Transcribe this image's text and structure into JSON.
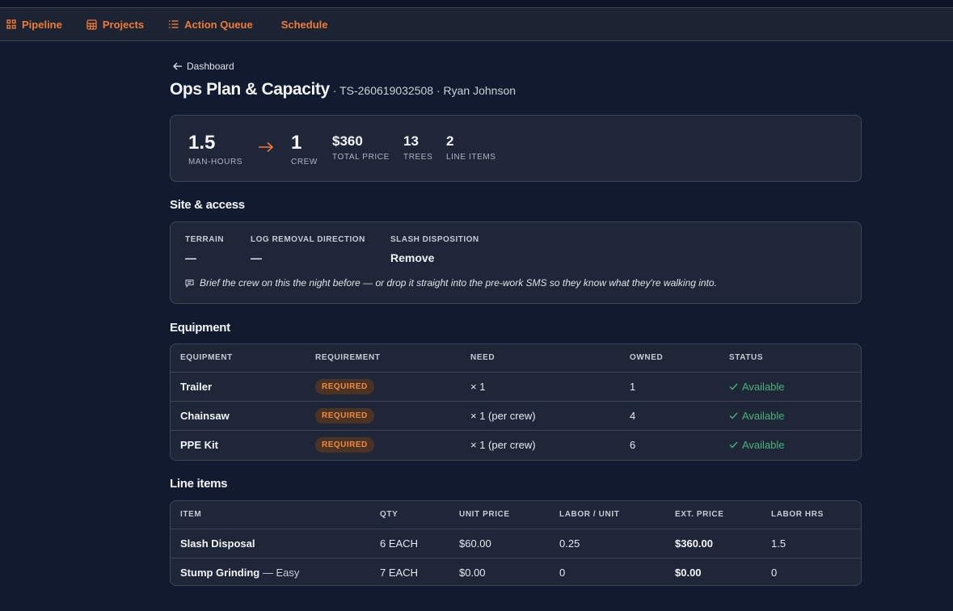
{
  "nav": {
    "items": [
      {
        "label": "Pipeline",
        "icon": "grid-icon"
      },
      {
        "label": "Projects",
        "icon": "calendar-grid-icon"
      },
      {
        "label": "Action Queue",
        "icon": "list-icon"
      },
      {
        "label": "Schedule",
        "icon": ""
      }
    ]
  },
  "back_link": "Dashboard",
  "page": {
    "title": "Ops Plan & Capacity",
    "subtitle": "· TS-260619032508 · Ryan Johnson"
  },
  "stats": {
    "man_hours": {
      "value": "1.5",
      "label": "MAN-HOURS"
    },
    "crew": {
      "value": "1",
      "label": "CREW"
    },
    "total_price": {
      "value": "$360",
      "label": "TOTAL PRICE"
    },
    "trees": {
      "value": "13",
      "label": "TREES"
    },
    "line_items": {
      "value": "2",
      "label": "LINE ITEMS"
    }
  },
  "site": {
    "title": "Site & access",
    "terrain": {
      "label": "TERRAIN",
      "value": "—"
    },
    "log_removal": {
      "label": "LOG REMOVAL DIRECTION",
      "value": "—"
    },
    "slash": {
      "label": "SLASH DISPOSITION",
      "value": "Remove"
    },
    "note": "Brief the crew on this the night before — or drop it straight into the pre-work SMS so they know what they're walking into."
  },
  "equipment": {
    "title": "Equipment",
    "headers": [
      "EQUIPMENT",
      "REQUIREMENT",
      "NEED",
      "OWNED",
      "STATUS"
    ],
    "rows": [
      {
        "name": "Trailer",
        "requirement": "REQUIRED",
        "need": "× 1",
        "owned": "1",
        "status": "Available"
      },
      {
        "name": "Chainsaw",
        "requirement": "REQUIRED",
        "need": "× 1 (per crew)",
        "owned": "4",
        "status": "Available"
      },
      {
        "name": "PPE Kit",
        "requirement": "REQUIRED",
        "need": "× 1 (per crew)",
        "owned": "6",
        "status": "Available"
      }
    ]
  },
  "line_items": {
    "title": "Line items",
    "headers": [
      "ITEM",
      "QTY",
      "UNIT PRICE",
      "LABOR / UNIT",
      "EXT. PRICE",
      "LABOR HRS"
    ],
    "rows": [
      {
        "item": "Slash Disposal",
        "variant": "",
        "qty": "6 EACH",
        "unit_price": "$60.00",
        "labor_unit": "0.25",
        "ext_price": "$360.00",
        "labor_hrs": "1.5"
      },
      {
        "item": "Stump Grinding",
        "variant": " — Easy",
        "qty": "7 EACH",
        "unit_price": "$0.00",
        "labor_unit": "0",
        "ext_price": "$0.00",
        "labor_hrs": "0"
      }
    ]
  },
  "colors": {
    "accent": "#f07b34",
    "background": "#111a2e",
    "card": "#1e2638",
    "success": "#4bb27a"
  }
}
